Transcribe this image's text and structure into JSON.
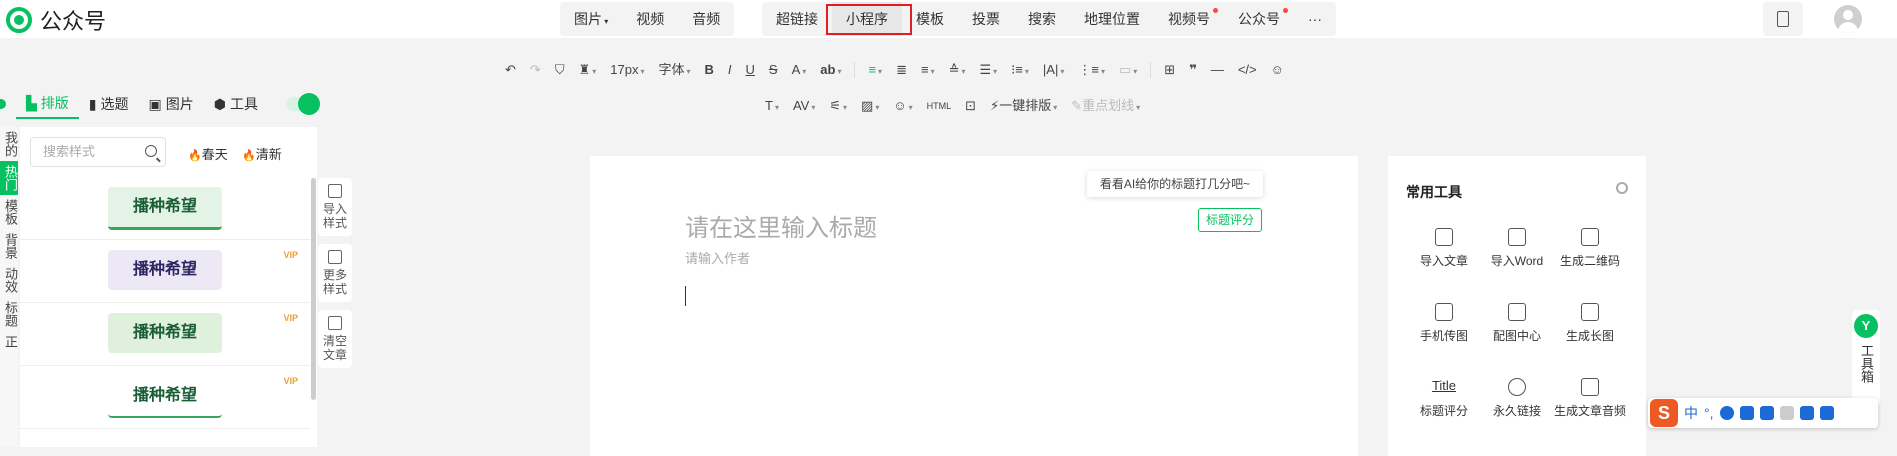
{
  "app": {
    "title": "公众号"
  },
  "topnav": {
    "group1": [
      "图片",
      "视频",
      "音频"
    ],
    "group2": [
      {
        "label": "超链接",
        "dot": false,
        "active": false
      },
      {
        "label": "小程序",
        "dot": false,
        "active": true
      },
      {
        "label": "模板",
        "dot": false,
        "active": false
      },
      {
        "label": "投票",
        "dot": false,
        "active": false
      },
      {
        "label": "搜索",
        "dot": false,
        "active": false
      },
      {
        "label": "地理位置",
        "dot": false,
        "active": false
      },
      {
        "label": "视频号",
        "dot": true,
        "active": false
      },
      {
        "label": "公众号",
        "dot": true,
        "active": false
      }
    ],
    "more": "···"
  },
  "format_toolbar": {
    "font_size": "17px",
    "font_family": "字体",
    "one_click_layout": "一键排版",
    "highlight_line": "重点划线"
  },
  "left_tabs": {
    "items": [
      {
        "label": "排版",
        "icon": "layout-icon"
      },
      {
        "label": "选题",
        "icon": "bookmark-icon"
      },
      {
        "label": "图片",
        "icon": "image-icon"
      },
      {
        "label": "工具",
        "icon": "cube-icon"
      }
    ]
  },
  "left_nav": [
    "我的",
    "热门",
    "模板",
    "背景",
    "动效",
    "标题",
    "正"
  ],
  "style_panel": {
    "search_placeholder": "搜索样式",
    "hot_tags": [
      "春天",
      "清新"
    ],
    "templates": [
      {
        "text": "播种希望",
        "vip": false
      },
      {
        "text": "播种希望",
        "vip": true
      },
      {
        "text": "播种希望",
        "vip": true
      },
      {
        "text": "播种希望",
        "vip": true
      }
    ],
    "vip_label": "VIP"
  },
  "side_tools": [
    "导入样式",
    "更多样式",
    "清空文章"
  ],
  "editor": {
    "ai_tip": "看看AI给你的标题打几分吧~",
    "score_button": "标题评分",
    "title_placeholder": "请在这里输入标题",
    "author_placeholder": "请输入作者"
  },
  "tools_panel": {
    "title": "常用工具",
    "tools": [
      {
        "label": "导入文章",
        "icon": "import-icon"
      },
      {
        "label": "导入Word",
        "icon": "word-icon"
      },
      {
        "label": "生成二维码",
        "icon": "qrcode-icon"
      },
      {
        "label": "手机传图",
        "icon": "phone-icon"
      },
      {
        "label": "配图中心",
        "icon": "picture-icon"
      },
      {
        "label": "生成长图",
        "icon": "long-image-icon"
      },
      {
        "label": "标题评分",
        "icon": "title-icon",
        "icon_text": "Title"
      },
      {
        "label": "永久链接",
        "icon": "link-icon"
      },
      {
        "label": "生成文章音频",
        "icon": "audio-icon"
      }
    ]
  },
  "right_strip": {
    "logo": "Y",
    "label": "工具箱"
  },
  "ime": {
    "logo": "S",
    "mode": "中",
    "punct": "°,"
  }
}
